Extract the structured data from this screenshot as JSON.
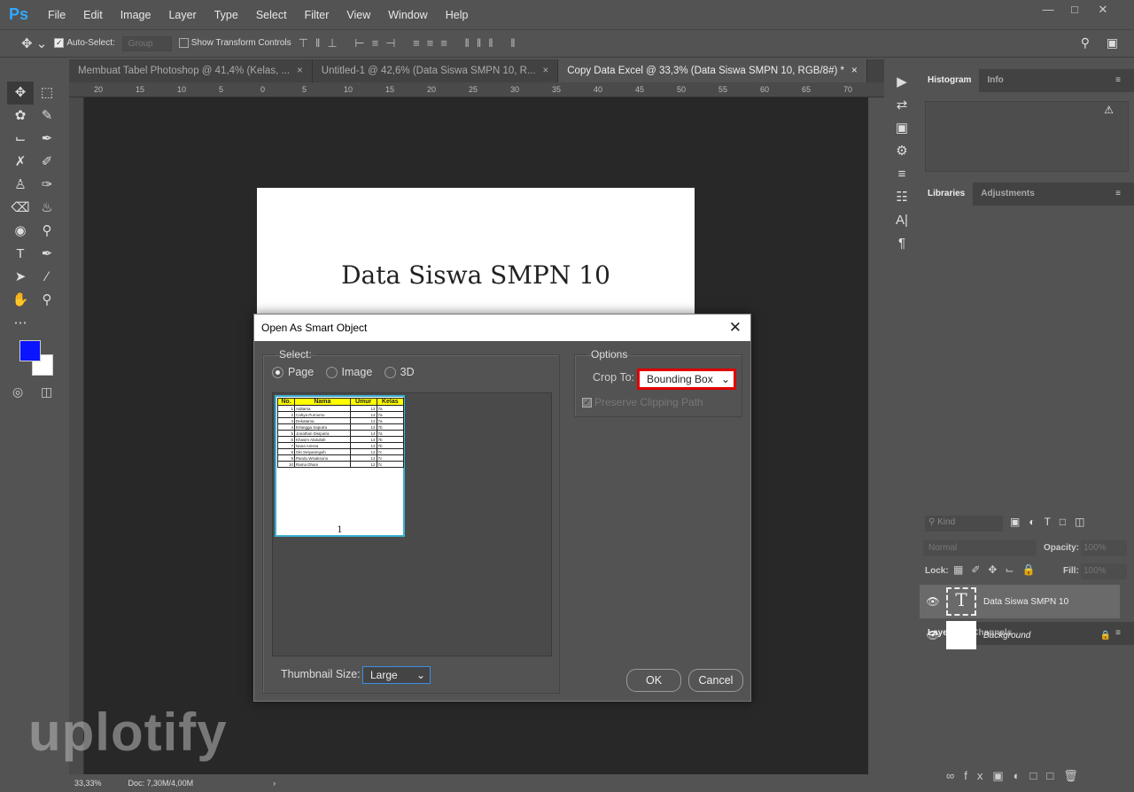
{
  "app": {
    "logo": "Ps",
    "menu": [
      "File",
      "Edit",
      "Image",
      "Layer",
      "Type",
      "Select",
      "Filter",
      "View",
      "Window",
      "Help"
    ]
  },
  "options": {
    "auto_select_label": "Auto-Select:",
    "auto_select_checked": true,
    "group_value": "Group",
    "show_transform_label": "Show Transform Controls",
    "show_transform_checked": false
  },
  "tabs": [
    {
      "label": "Membuat Tabel Photoshop @ 41,4% (Kelas, ..."
    },
    {
      "label": "Untitled-1 @ 42,6% (Data Siswa SMPN 10, R..."
    },
    {
      "label": "Copy Data Excel @ 33,3% (Data Siswa SMPN 10, RGB/8#) *",
      "active": true
    }
  ],
  "ruler_ticks": [
    "20",
    "15",
    "10",
    "5",
    "0",
    "5",
    "10",
    "15",
    "20",
    "25",
    "30",
    "35",
    "40",
    "45",
    "50",
    "55",
    "60",
    "65",
    "70"
  ],
  "document": {
    "title": "Data Siswa SMPN 10"
  },
  "colors": {
    "foreground": "#0a14ff",
    "background": "#ffffff",
    "crop_highlight": "#e00000"
  },
  "status": {
    "zoom": "33,33%",
    "doc": "Doc: 7,30M/4,00M"
  },
  "right_panel": {
    "top_tabs": [
      "Histogram",
      "Info"
    ],
    "mid_tabs": [
      "Libraries",
      "Adjustments"
    ],
    "layer_tabs": [
      "Layers",
      "Channels"
    ],
    "kind_placeholder": "Kind",
    "blend_mode": "Normal",
    "opacity_label": "Opacity:",
    "opacity_value": "100%",
    "lock_label": "Lock:",
    "fill_label": "Fill:",
    "fill_value": "100%",
    "layers": [
      {
        "name": "Data Siswa SMPN 10",
        "type": "text",
        "selected": true
      },
      {
        "name": "Background",
        "type": "image",
        "locked": true
      }
    ]
  },
  "dialog": {
    "title": "Open As Smart Object",
    "select_legend": "Select:",
    "radios": [
      {
        "label": "Page",
        "checked": true
      },
      {
        "label": "Image",
        "checked": false
      },
      {
        "label": "3D",
        "checked": false
      }
    ],
    "options_legend": "Options",
    "crop_label": "Crop To:",
    "crop_value": "Bounding Box",
    "preserve_label": "Preserve Clipping Path",
    "preserve_checked": true,
    "thumb_size_label": "Thumbnail Size:",
    "thumb_size_value": "Large",
    "ok": "OK",
    "cancel": "Cancel",
    "page_number": "1",
    "table": {
      "headers": [
        "No.",
        "Nama",
        "Umur",
        "Kelas"
      ],
      "rows": [
        [
          "1",
          "Aditama",
          "13",
          "7a"
        ],
        [
          "2",
          "Cahya Purnomo",
          "14",
          "7a"
        ],
        [
          "3",
          "Dekatama",
          "13",
          "7a"
        ],
        [
          "4",
          "Erlangga Saputra",
          "13",
          "7b"
        ],
        [
          "5",
          "Jonathan Dwiputra",
          "14",
          "7a"
        ],
        [
          "6",
          "Khasim Abdullah",
          "14",
          "7b"
        ],
        [
          "7",
          "Nana Anissa",
          "13",
          "7b"
        ],
        [
          "8",
          "Oki Setyaningsih",
          "13",
          "7c"
        ],
        [
          "9",
          "Pandu Wisaksono",
          "13",
          "7c"
        ],
        [
          "10",
          "Rama Dhani",
          "12",
          "7c"
        ]
      ]
    }
  },
  "watermark": "uplotify"
}
